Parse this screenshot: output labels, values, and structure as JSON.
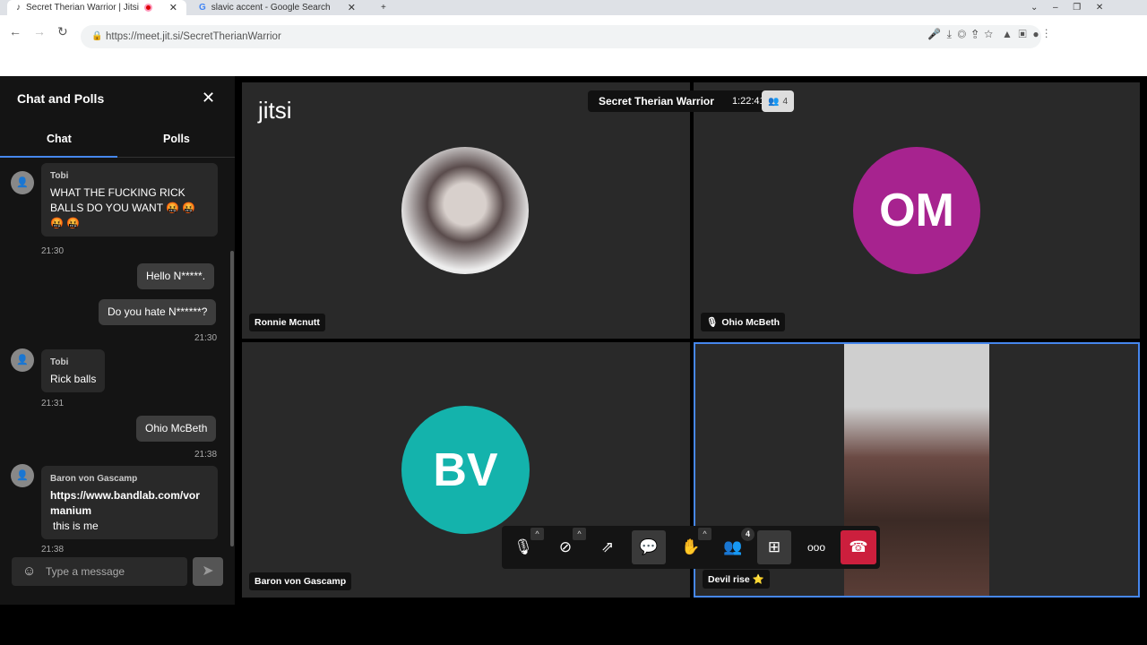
{
  "browser": {
    "tabs": [
      {
        "title": "Secret Therian Warrior | Jitsi"
      },
      {
        "title": "slavic accent - Google Search"
      }
    ],
    "url": "https://meet.jit.si/SecretTherianWarrior"
  },
  "sidebar": {
    "title": "Chat and Polls",
    "tabs": [
      "Chat",
      "Polls"
    ],
    "input_placeholder": "Type a message",
    "messages": [
      {
        "sender": "Tobi",
        "text": "WHAT THE FUCKING RICK BALLS DO YOU WANT 🤬 🤬 🤬 🤬",
        "time": "21:30"
      },
      {
        "text": "Hello N*****.",
        "mine": true
      },
      {
        "text": "Do you hate N******?",
        "mine": true,
        "time": "21:30"
      },
      {
        "sender": "Tobi",
        "text": "Rick balls",
        "time": "21:31"
      },
      {
        "text": "Ohio McBeth",
        "mine": true,
        "time": "21:38"
      },
      {
        "sender": "Baron von Gascamp",
        "link": "https://www.bandlab.com/vormanium",
        "text": "this is me",
        "time": "21:38"
      }
    ]
  },
  "meeting": {
    "logo": "jitsi",
    "title": "Secret Therian Warrior",
    "timer": "1:22:41",
    "participant_count": "4",
    "participants": [
      {
        "name": "Ronnie Mcnutt"
      },
      {
        "name": "Ohio McBeth",
        "initials": "OM",
        "color": "#a7238f"
      },
      {
        "name": "Baron von Gascamp",
        "initials": "BV",
        "color": "#14b3ac"
      },
      {
        "name": "Devil rise ⭐"
      }
    ]
  },
  "toolbar": {
    "participants_badge": "4"
  }
}
